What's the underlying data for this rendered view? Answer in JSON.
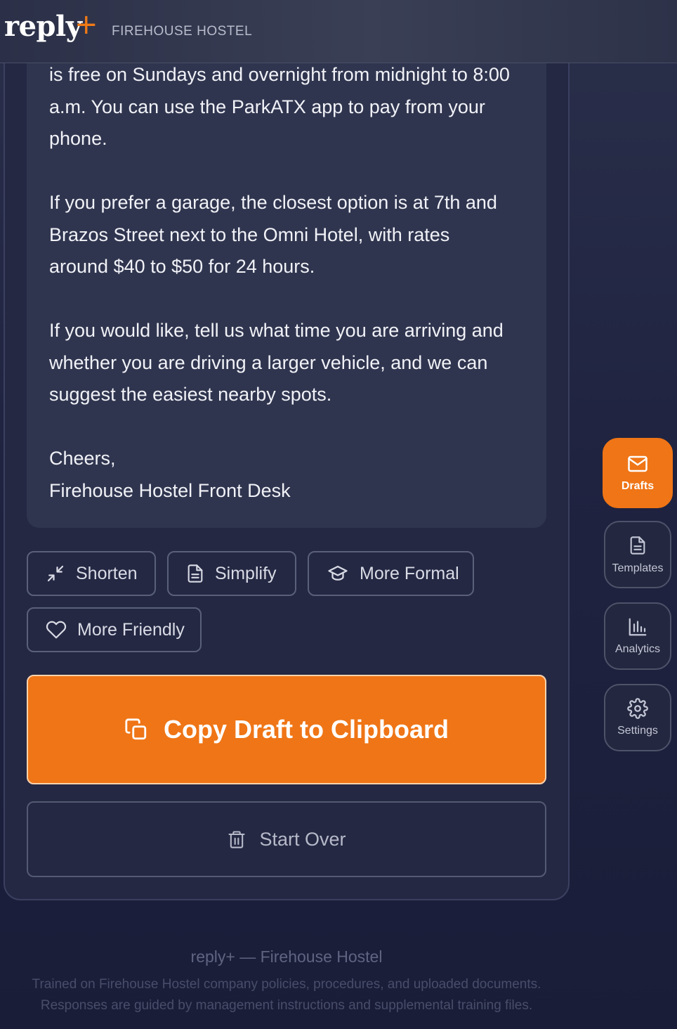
{
  "header": {
    "logo": "reply",
    "logo_plus": "+",
    "org_name": "FIREHOUSE HOSTEL"
  },
  "draft": {
    "paragraphs": [
      "is free on Sundays and overnight from midnight to 8:00\na.m. You can use the ParkATX app to pay from your\nphone.",
      "If you prefer a garage, the closest option is at 7th and\nBrazos Street next to the Omni Hotel, with rates\naround $40 to $50 for 24 hours.",
      "If you would like, tell us what time you are arriving and\nwhether you are driving a larger vehicle, and we can\nsuggest the easiest nearby spots.",
      "Cheers,\nFirehouse Hostel Front Desk"
    ]
  },
  "tone_actions": [
    {
      "label": "Shorten",
      "icon": "shrink-arrows-icon"
    },
    {
      "label": "Simplify",
      "icon": "document-icon"
    },
    {
      "label": "More Formal",
      "icon": "graduation-cap-icon"
    },
    {
      "label": "More Friendly",
      "icon": "heart-icon"
    }
  ],
  "copy_button": {
    "label": "Copy Draft to Clipboard",
    "icon": "copy-icon"
  },
  "start_over": {
    "label": "Start Over",
    "icon": "trash-icon"
  },
  "sidebar": [
    {
      "label": "Drafts",
      "icon": "envelope-icon",
      "active": true
    },
    {
      "label": "Templates",
      "icon": "document-icon",
      "active": false
    },
    {
      "label": "Analytics",
      "icon": "bar-chart-icon",
      "active": false
    },
    {
      "label": "Settings",
      "icon": "gear-icon",
      "active": false
    }
  ],
  "footer": {
    "title": "reply+ — Firehouse Hostel",
    "line1": "Trained on Firehouse Hostel company policies, procedures, and uploaded documents.",
    "line2": "Responses are guided by management instructions and supplemental training files."
  },
  "colors": {
    "accent": "#ef7516",
    "background": "#1f2340",
    "card": "#30354f"
  }
}
